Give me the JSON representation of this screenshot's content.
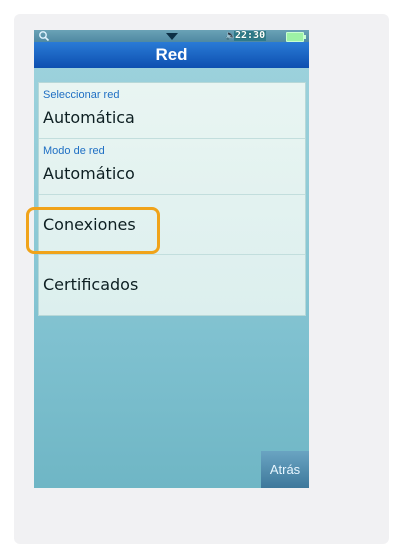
{
  "statusbar": {
    "time": "22:30",
    "speaker_glyph": "🔈",
    "icons": [
      "search-icon",
      "dropdown-arrow-icon",
      "speaker-icon",
      "battery-icon"
    ]
  },
  "title": "Red",
  "items": [
    {
      "sublabel": "Seleccionar red",
      "value": "Automática"
    },
    {
      "sublabel": "Modo de red",
      "value": "Automático"
    },
    {
      "label": "Conexiones"
    },
    {
      "label": "Certificados"
    }
  ],
  "back_label": "Atrás",
  "colors": {
    "title_bar": "#0d4fb0",
    "sublabel": "#1f6fc4",
    "highlight": "#f0a31a"
  }
}
